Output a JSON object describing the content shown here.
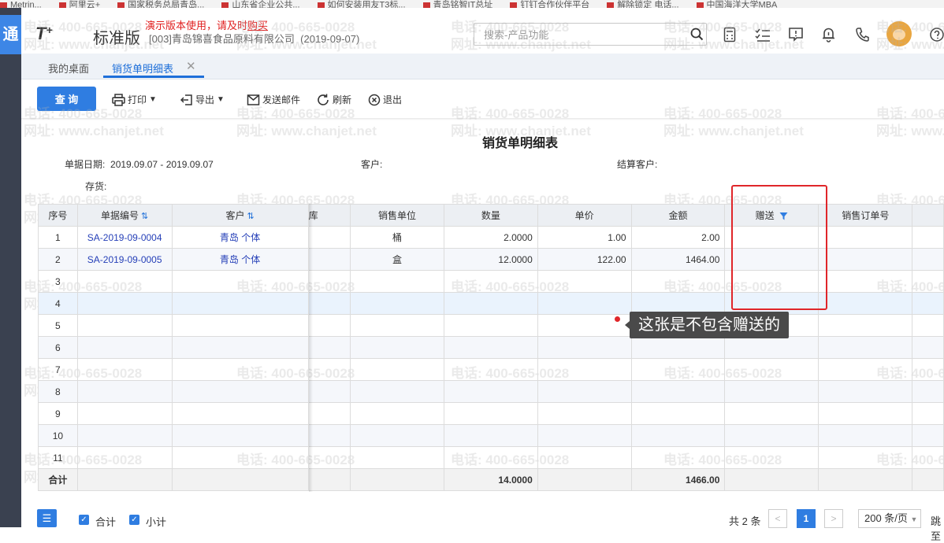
{
  "browser": {
    "bookmarks": [
      "Metrin...",
      "阿里云+",
      "国家税务总局青岛...",
      "山东省企业公共...",
      "如何安装用友T3标...",
      "青岛铭智IT总址",
      "钉钉合作伙伴平台",
      "解除锁定 电话...",
      "中国海洋大学MBA"
    ]
  },
  "sidebar": {
    "top_glyph": "通"
  },
  "header": {
    "logo": "T",
    "logo_plus": "+",
    "edition": "标准版",
    "demo_notice_prefix": "演示版本使用，请及时",
    "demo_notice_link": "购买",
    "company": "[003]青岛锦喜食品原料有限公司",
    "company_date": "(2019-09-07)",
    "search_placeholder": "搜索-产品功能",
    "icons": [
      "search-icon",
      "calculator-icon",
      "checklist-icon",
      "message-icon",
      "bell-icon",
      "phone-icon",
      "help-icon"
    ]
  },
  "tabs": [
    {
      "label": "我的桌面"
    },
    {
      "label": "销货单明细表",
      "active": true
    }
  ],
  "toolbar": {
    "query": "查 询",
    "print": "打印",
    "export": "导出",
    "email": "发送邮件",
    "refresh": "刷新",
    "exit": "退出"
  },
  "report": {
    "title": "销货单明细表",
    "date_label": "单据日期:",
    "date_value": "2019.09.07 - 2019.09.07",
    "customer_label": "客户:",
    "settle_label": "结算客户:",
    "stock_label": "存货:"
  },
  "grid": {
    "headers": {
      "seq": "序号",
      "doc_no": "单据编号",
      "customer": "客户",
      "hidden": "库",
      "unit": "销售单位",
      "qty": "数量",
      "price": "单价",
      "amount": "金额",
      "gift": "赠送",
      "order_no": "销售订单号"
    },
    "rows": [
      {
        "seq": "1",
        "doc_no": "SA-2019-09-0004",
        "customer": "青岛 个体",
        "unit": "桶",
        "qty": "2.0000",
        "price": "1.00",
        "amount": "2.00"
      },
      {
        "seq": "2",
        "doc_no": "SA-2019-09-0005",
        "customer": "青岛 个体",
        "unit": "盒",
        "qty": "12.0000",
        "price": "122.00",
        "amount": "1464.00"
      },
      {
        "seq": "3"
      },
      {
        "seq": "4"
      },
      {
        "seq": "5"
      },
      {
        "seq": "6"
      },
      {
        "seq": "7"
      },
      {
        "seq": "8"
      },
      {
        "seq": "9"
      },
      {
        "seq": "10"
      },
      {
        "seq": "11"
      }
    ],
    "total": {
      "label": "合计",
      "qty": "14.0000",
      "amount": "1466.00"
    }
  },
  "annotation": {
    "callout": "这张是不包含赠送的",
    "box_color": "#e0262a"
  },
  "watermark": {
    "line1": "电话: 400-665-0028",
    "line2": "网址: www.chanjet.net"
  },
  "footer": {
    "sum_label": "合计",
    "subtotal_label": "小计",
    "total_count": "共 2 条",
    "prev": "<",
    "page": "1",
    "next": ">",
    "page_size": "200 条/页",
    "jump": "跳至"
  },
  "colors": {
    "accent": "#2f7de1",
    "link": "#2640b8",
    "danger": "#e02020"
  }
}
